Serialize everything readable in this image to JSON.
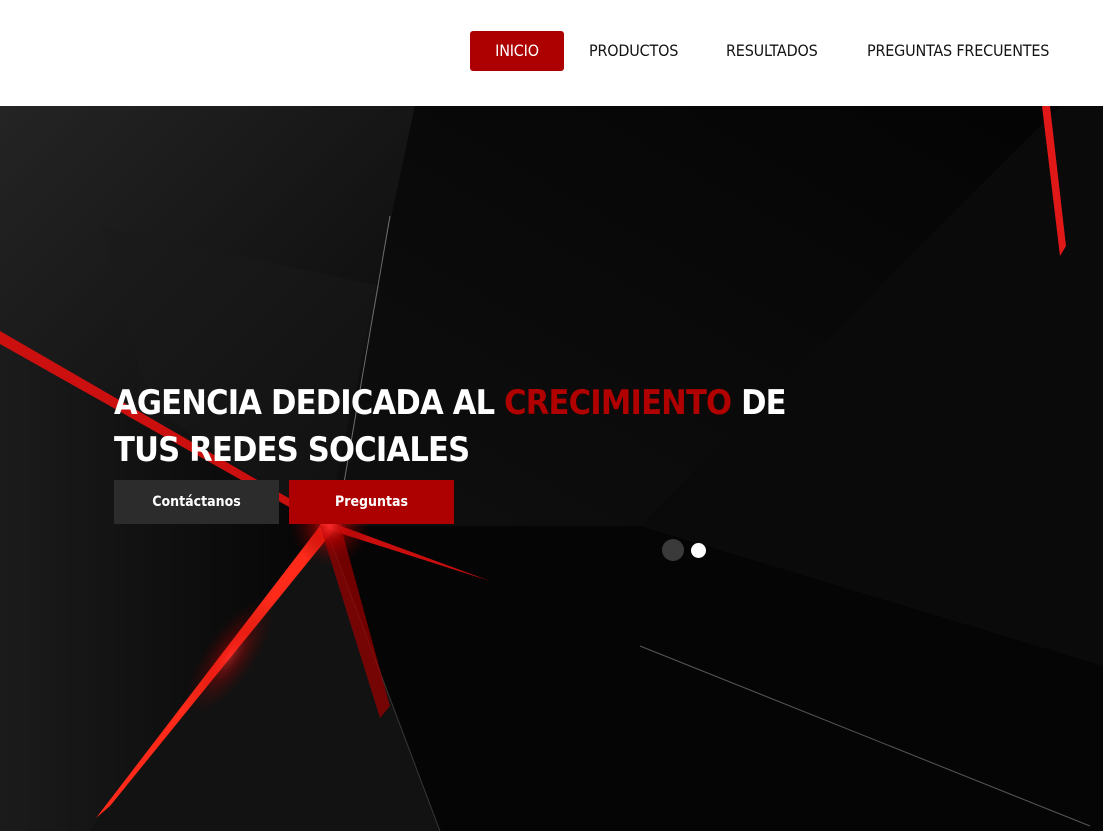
{
  "nav": {
    "items": [
      {
        "label": "INICIO",
        "active": true
      },
      {
        "label": "PRODUCTOS",
        "active": false
      },
      {
        "label": "RESULTADOS",
        "active": false
      },
      {
        "label": "PREGUNTAS FRECUENTES",
        "active": false
      }
    ]
  },
  "hero": {
    "headline": {
      "part1": "AGENCIA DEDICADA AL ",
      "highlight": "CRECIMIENTO",
      "part2": " DE TUS REDES SOCIALES"
    },
    "buttons": {
      "contact": "Contáctanos",
      "faq": "Preguntas"
    },
    "slider": {
      "dot_count": 2,
      "active_dot": 2
    }
  },
  "colors": {
    "accent": "#ad0000",
    "highlight_text": "#b00000",
    "secondary_button": "#2c2c2c",
    "hero_background": "#030303"
  }
}
